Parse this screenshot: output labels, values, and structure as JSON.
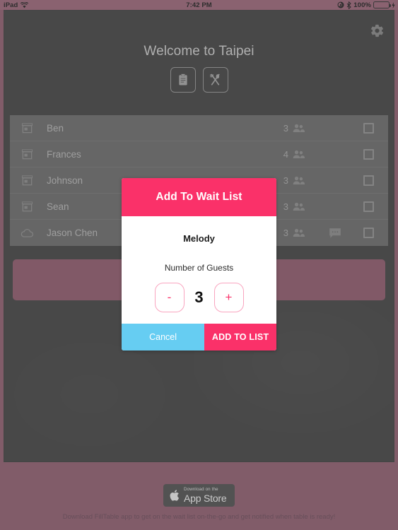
{
  "status_bar": {
    "device": "iPad",
    "wifi_icon": "wifi-icon",
    "time": "7:42 PM",
    "rotation_lock_icon": "rotation-lock-icon",
    "bluetooth_icon": "bluetooth-icon",
    "battery_percent": "100%",
    "battery_icon": "battery-charging-icon",
    "battery_color": "#44e34a"
  },
  "header": {
    "title": "Welcome to Taipei",
    "gear_icon": "gear-icon",
    "actions": [
      {
        "icon": "clipboard-icon",
        "name": "waitlist-view-button"
      },
      {
        "icon": "utensils-crossed-icon",
        "name": "menu-view-button"
      }
    ]
  },
  "waitlist": {
    "rows": [
      {
        "source_icon": "store-icon",
        "name": "Ben",
        "guests": "3",
        "people_icon": "people-icon",
        "has_message": false,
        "checked": false
      },
      {
        "source_icon": "store-icon",
        "name": "Frances",
        "guests": "4",
        "people_icon": "people-icon",
        "has_message": false,
        "checked": false
      },
      {
        "source_icon": "store-icon",
        "name": "Johnson",
        "guests": "3",
        "people_icon": "people-icon",
        "has_message": false,
        "checked": false
      },
      {
        "source_icon": "store-icon",
        "name": "Sean",
        "guests": "3",
        "people_icon": "people-icon",
        "has_message": false,
        "checked": false
      },
      {
        "source_icon": "cloud-icon",
        "name": "Jason Chen",
        "guests": "3",
        "people_icon": "people-icon",
        "has_message": true,
        "message_icon": "message-bubble-icon",
        "checked": false
      }
    ]
  },
  "join_bar": {
    "name": "join-wait-list-button",
    "color": "#8a5f6e"
  },
  "modal": {
    "title": "Add To Wait List",
    "guest_name": "Melody",
    "guests_label": "Number of Guests",
    "guest_count": "3",
    "decrement_label": "-",
    "increment_label": "+",
    "cancel_label": "Cancel",
    "submit_label": "ADD TO LIST",
    "accent_color": "#fa3169",
    "cancel_color": "#66cdf2"
  },
  "footer": {
    "appstore_line1": "Download on the",
    "appstore_line2": "App Store",
    "apple_icon": "apple-logo-icon",
    "note": "Download FillTable app to get on the wait list on-the-go and get notified when table is ready!"
  }
}
